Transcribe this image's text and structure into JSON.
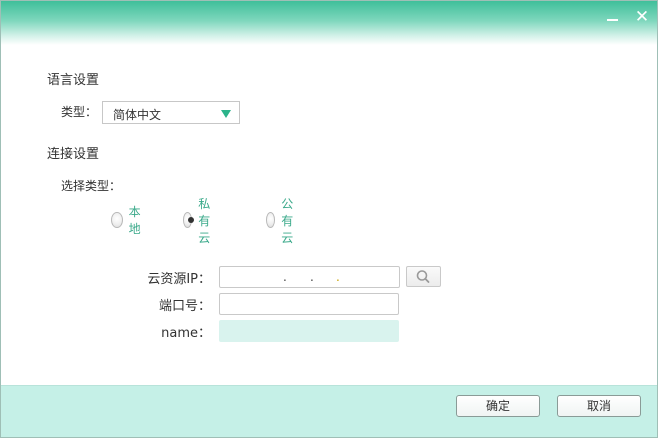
{
  "window": {
    "minimize_symbol": "",
    "close_symbol": "✕"
  },
  "language": {
    "section_title": "语言设置",
    "type_label": "类型：",
    "type_value": "简体中文"
  },
  "connection": {
    "section_title": "连接设置",
    "choose_type_label": "选择类型：",
    "options": [
      {
        "label": "本地",
        "checked": false
      },
      {
        "label": "私有云",
        "checked": true
      },
      {
        "label": "公有云",
        "checked": false
      }
    ]
  },
  "form": {
    "ip_label": "云资源IP：",
    "ip_dots": [
      ".",
      ".",
      "."
    ],
    "port_label": "端口号：",
    "name_label": "name："
  },
  "footer": {
    "ok_label": "确定",
    "cancel_label": "取消"
  },
  "colors": {
    "accent": "#2bb38a",
    "footer_bg": "#c5f0e7",
    "radio_text": "#3aa98a"
  }
}
